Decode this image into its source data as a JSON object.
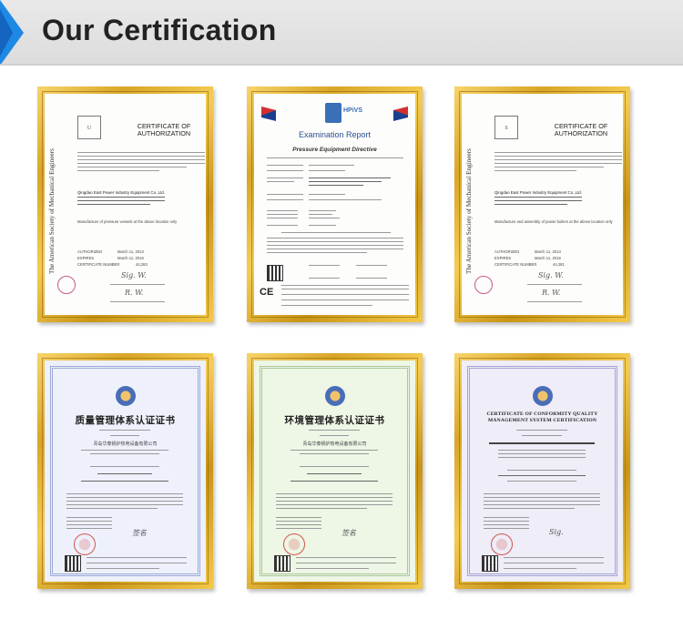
{
  "header": {
    "title": "Our Certification",
    "accent_color": "#1e88e5"
  },
  "certificates": [
    {
      "kind": "asme-certificate",
      "side_text": "The American Society of Mechanical Engineers",
      "title_line1": "CERTIFICATE OF",
      "title_line2": "AUTHORIZATION",
      "company": "Qingdao East Power Industry Equipment Co.,Ltd.",
      "scope": "Manufacture of pressure vessels at the above location only",
      "authorized_label": "AUTHORIZED",
      "authorized_value": "March 11, 2013",
      "expires_label": "EXPIRES",
      "expires_value": "March 11, 2016",
      "number_label": "CERTIFICATE NUMBER",
      "number_value": "44,283"
    },
    {
      "kind": "examination-report",
      "logo_text": "HPiVS",
      "title": "Examination Report",
      "subtitle": "Pressure Equipment Directive",
      "ce_mark": "CE"
    },
    {
      "kind": "asme-certificate",
      "side_text": "The American Society of Mechanical Engineers",
      "title_line1": "CERTIFICATE OF",
      "title_line2": "AUTHORIZATION",
      "company": "Qingdao East Power Industry Equipment Co.,Ltd.",
      "scope": "Manufacture and assembly of power boilers at the above location only",
      "authorized_label": "AUTHORIZED",
      "authorized_value": "March 11, 2013",
      "expires_label": "EXPIRES",
      "expires_value": "March 11, 2016",
      "number_label": "CERTIFICATE NUMBER",
      "number_value": "44,281"
    },
    {
      "kind": "quality-certificate",
      "title": "质量管理体系认证证书",
      "company": "青岛华泰锅炉热电设备有限公司"
    },
    {
      "kind": "environment-certificate",
      "title": "环境管理体系认证证书",
      "company": "青岛华泰锅炉热电设备有限公司"
    },
    {
      "kind": "quality-certificate-en",
      "title_line1": "CERTIFICATE OF CONFORMITY QUALITY",
      "title_line2": "MANAGEMENT SYSTEM CERTIFICATION"
    }
  ]
}
